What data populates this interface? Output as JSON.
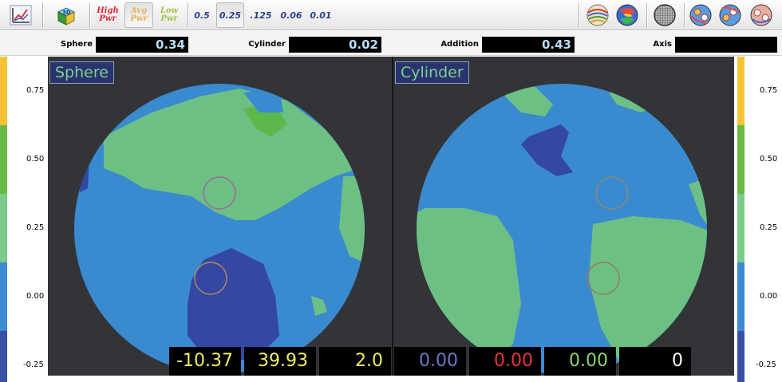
{
  "toolbar": {
    "high_pwr_label": "High\nPwr",
    "avg_pwr_label": "Avg\nPwr",
    "low_pwr_label": "Low\nPwr",
    "steps": [
      "0.5",
      "0.25",
      ".125",
      "0.06",
      "0.01"
    ],
    "selected_step": "0.25",
    "selected_power": "Avg",
    "colors": {
      "high": "#e0283a",
      "avg": "#e8b25a",
      "low": "#9fc744",
      "step_text": "#2c3f8a"
    }
  },
  "readouts": {
    "sphere_label": "Sphere",
    "sphere_value": "0.34",
    "cylinder_label": "Cylinder",
    "cylinder_value": "0.02",
    "addition_label": "Addition",
    "addition_value": "0.43",
    "axis_label": "Axis",
    "axis_value": ""
  },
  "scale": {
    "ticks": [
      "0.75",
      "0.50",
      "0.25",
      "0.00",
      "-0.25"
    ],
    "colors": [
      "#f7c235",
      "#6ab945",
      "#7ccb89",
      "#3b8bd4",
      "#3a4fa8"
    ]
  },
  "panes": {
    "sphere_title": "Sphere",
    "cylinder_title": "Cylinder"
  },
  "map_colors": {
    "background": "#333437",
    "green": "#6cc084",
    "blue": "#3a8ad0",
    "dark_blue": "#3347a3"
  },
  "bottom": {
    "v1": "-10.37",
    "v2": "39.93",
    "v3": "2.0",
    "v4": "0.00",
    "v5": "0.00",
    "v6": "0.00",
    "v7": "0",
    "colors": {
      "yellow": "#f0ec6a",
      "purple": "#6d78c8",
      "red": "#e3343c",
      "green": "#8ad36b",
      "white": "#ffffff"
    }
  }
}
